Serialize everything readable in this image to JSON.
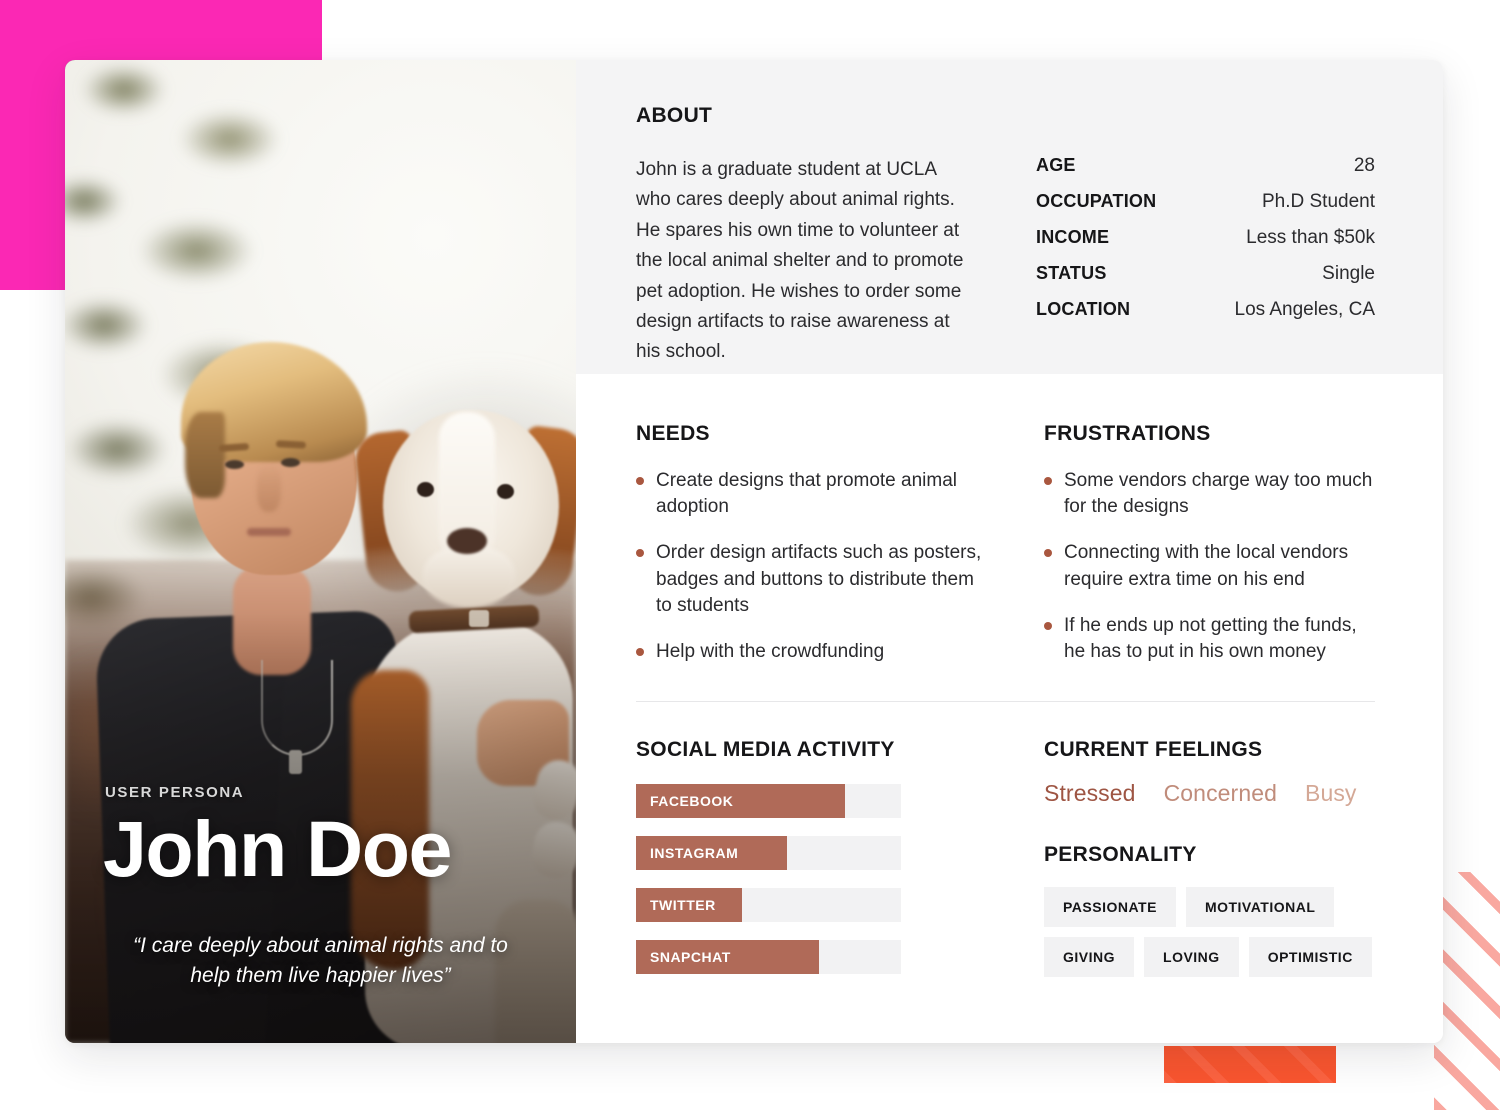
{
  "theme": {
    "pink_square": "#FB28B4",
    "orange_bar": "#F9552F",
    "stripe_pink": "#F9A8A0",
    "bar_fill": "#B06A58",
    "bullet": "#A9573F",
    "panel_grey": "#F4F4F5",
    "tag_grey": "#F2F2F3"
  },
  "photo": {
    "kicker": "USER PERSONA",
    "name": "John Doe",
    "quote": "“I care deeply about animal rights and to help them live happier lives”"
  },
  "about": {
    "title": "ABOUT",
    "description": "John is a graduate student at UCLA who cares deeply about animal rights. He spares his own time to volunteer at the local animal shelter and to promote pet adoption. He wishes to order some design artifacts to raise awareness at his school.",
    "stats": [
      {
        "label": "AGE",
        "value": "28"
      },
      {
        "label": "OCCUPATION",
        "value": "Ph.D Student"
      },
      {
        "label": "INCOME",
        "value": "Less than $50k"
      },
      {
        "label": "STATUS",
        "value": "Single"
      },
      {
        "label": "LOCATION",
        "value": "Los Angeles, CA"
      }
    ]
  },
  "needs": {
    "title": "NEEDS",
    "items": [
      "Create designs that promote animal adoption",
      "Order design artifacts such as posters, badges and buttons to distribute them to students",
      "Help with the crowdfunding"
    ]
  },
  "frustrations": {
    "title": "FRUSTRATIONS",
    "items": [
      "Some vendors charge way too much for the designs",
      "Connecting with the local vendors require extra time on his end",
      "If he ends up not getting the funds, he has to put in his own money"
    ]
  },
  "social": {
    "title": "SOCIAL MEDIA ACTIVITY",
    "items": [
      {
        "label": "FACEBOOK",
        "percent": 79
      },
      {
        "label": "INSTAGRAM",
        "percent": 57
      },
      {
        "label": "TWITTER",
        "percent": 40
      },
      {
        "label": "SNAPCHAT",
        "percent": 69
      }
    ]
  },
  "feelings": {
    "title": "CURRENT FEELINGS",
    "items": [
      {
        "label": "Stressed",
        "color": "#9E5543"
      },
      {
        "label": "Concerned",
        "color": "#C08C7B"
      },
      {
        "label": "Busy",
        "color": "#D4A896"
      }
    ]
  },
  "personality": {
    "title": "PERSONALITY",
    "tags": [
      "PASSIONATE",
      "MOTIVATIONAL",
      "GIVING",
      "LOVING",
      "OPTIMISTIC"
    ]
  }
}
